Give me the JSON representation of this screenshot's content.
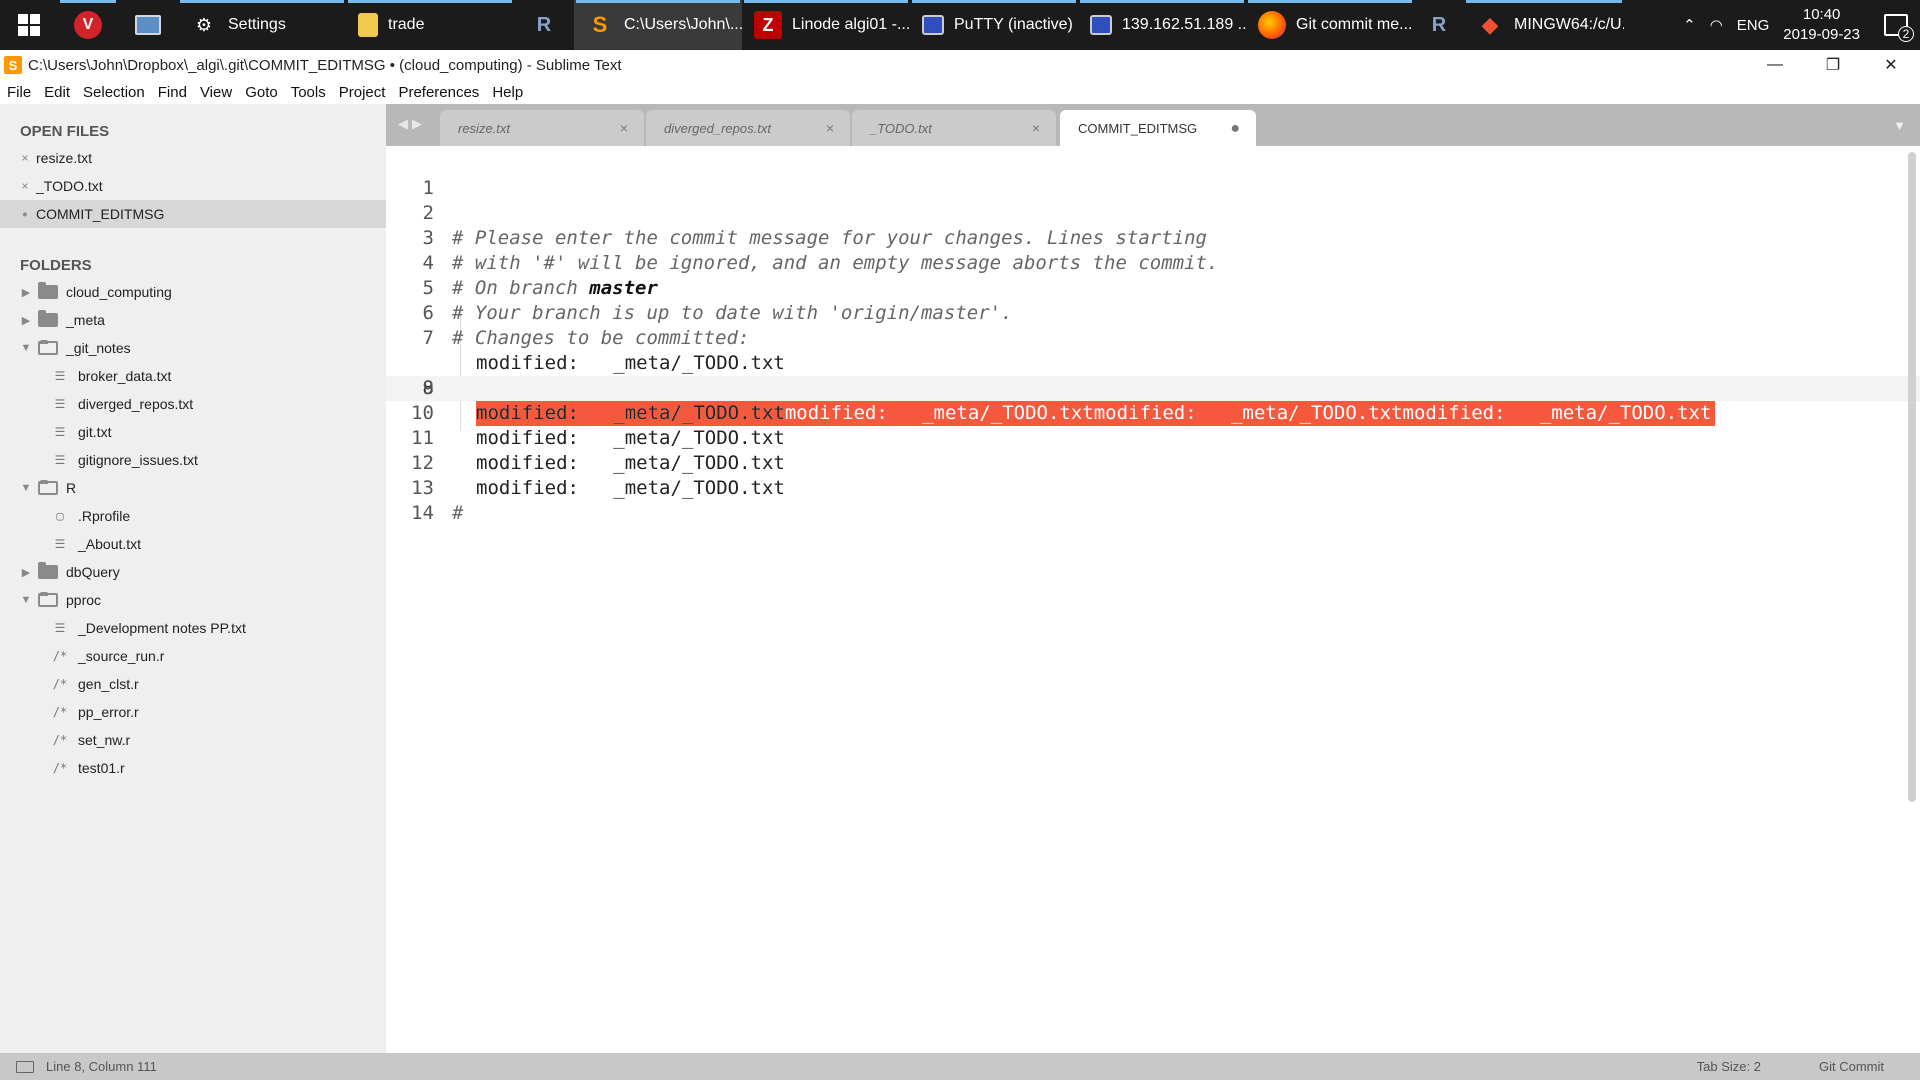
{
  "taskbar": {
    "items": [
      {
        "label": "Settings",
        "icon": "gear-icon"
      },
      {
        "label": "trade",
        "icon": "folder-icon"
      },
      {
        "label": "C:\\Users\\John\\...",
        "icon": "sublime-icon"
      },
      {
        "label": "Linode algi01 -...",
        "icon": "filezilla-icon"
      },
      {
        "label": "PuTTY (inactive)",
        "icon": "putty-icon"
      },
      {
        "label": "139.162.51.189 ...",
        "icon": "putty-icon"
      },
      {
        "label": "Git commit me...",
        "icon": "firefox-icon"
      },
      {
        "label": "MINGW64:/c/U...",
        "icon": "git-icon"
      }
    ],
    "tray": {
      "lang": "ENG",
      "time": "10:40",
      "date": "2019-09-23",
      "notifications": "2"
    }
  },
  "window": {
    "title": "C:\\Users\\John\\Dropbox\\_algi\\.git\\COMMIT_EDITMSG • (cloud_computing) - Sublime Text",
    "menu": [
      "File",
      "Edit",
      "Selection",
      "Find",
      "View",
      "Goto",
      "Tools",
      "Project",
      "Preferences",
      "Help"
    ]
  },
  "sidebar": {
    "open_files_title": "OPEN FILES",
    "open_files": [
      {
        "label": "resize.txt",
        "marker": "×"
      },
      {
        "label": "_TODO.txt",
        "marker": "×"
      },
      {
        "label": "COMMIT_EDITMSG",
        "marker": "●"
      }
    ],
    "folders_title": "FOLDERS",
    "tree": [
      {
        "label": "cloud_computing",
        "type": "folder",
        "open": false,
        "depth": 0
      },
      {
        "label": "_meta",
        "type": "folder",
        "open": false,
        "depth": 0
      },
      {
        "label": "_git_notes",
        "type": "folder",
        "open": true,
        "depth": 0
      },
      {
        "label": "broker_data.txt",
        "type": "txt",
        "depth": 1
      },
      {
        "label": "diverged_repos.txt",
        "type": "txt",
        "depth": 1
      },
      {
        "label": "git.txt",
        "type": "txt",
        "depth": 1
      },
      {
        "label": "gitignore_issues.txt",
        "type": "txt",
        "depth": 1
      },
      {
        "label": "R",
        "type": "folder",
        "open": true,
        "depth": 0
      },
      {
        "label": ".Rprofile",
        "type": "plain",
        "depth": 1
      },
      {
        "label": "_About.txt",
        "type": "txt",
        "depth": 1
      },
      {
        "label": "dbQuery",
        "type": "folder",
        "open": false,
        "depth": 0
      },
      {
        "label": "pproc",
        "type": "folder",
        "open": true,
        "depth": 0
      },
      {
        "label": "_Development notes PP.txt",
        "type": "txt",
        "depth": 1
      },
      {
        "label": "_source_run.r",
        "type": "r",
        "depth": 1
      },
      {
        "label": "gen_clst.r",
        "type": "r",
        "depth": 1
      },
      {
        "label": "pp_error.r",
        "type": "r",
        "depth": 1
      },
      {
        "label": "set_nw.r",
        "type": "r",
        "depth": 1
      },
      {
        "label": "test01.r",
        "type": "r",
        "depth": 1
      }
    ]
  },
  "tabs": [
    {
      "label": "resize.txt",
      "close": "×",
      "active": false
    },
    {
      "label": "diverged_repos.txt",
      "close": "×",
      "active": false
    },
    {
      "label": "_TODO.txt",
      "close": "×",
      "active": false
    },
    {
      "label": "COMMIT_EDITMSG",
      "close": "●",
      "active": true
    }
  ],
  "editor": {
    "current_line": 8,
    "lines": [
      {
        "n": "1",
        "text": ""
      },
      {
        "n": "2",
        "text": "# Please enter the commit message for your changes. Lines starting",
        "kind": "comment"
      },
      {
        "n": "3",
        "text": "# with '#' will be ignored, and an empty message aborts the commit.",
        "kind": "comment"
      },
      {
        "n": "4",
        "text": "# On branch ",
        "bold": "master",
        "kind": "comment"
      },
      {
        "n": "5",
        "text": "# Your branch is up to date with 'origin/master'.",
        "kind": "comment"
      },
      {
        "n": "6",
        "text": "# Changes to be committed:",
        "kind": "comment"
      },
      {
        "n": "7",
        "text": "modified:   _meta/_TODO.txt",
        "kind": "indent"
      },
      {
        "n": "8",
        "text": "modified:   _meta/_TODO.txtmodified:   _meta/_TODO.txtmodified:   _meta/_TODO.txtmodified:   _meta/_TODO.txt",
        "kind": "error"
      },
      {
        "n": "9",
        "text": "modified:   _meta/_TODO.txt",
        "kind": "indent"
      },
      {
        "n": "10",
        "text": "modified:   _meta/_TODO.txt",
        "kind": "indent"
      },
      {
        "n": "11",
        "text": "modified:   _meta/_TODO.txt",
        "kind": "indent"
      },
      {
        "n": "12",
        "text": "modified:   _meta/_TODO.txt",
        "kind": "indent"
      },
      {
        "n": "13",
        "text": "#",
        "kind": "comment"
      },
      {
        "n": "14",
        "text": ""
      }
    ]
  },
  "status": {
    "position": "Line 8, Column 111",
    "tab_size": "Tab Size: 2",
    "syntax": "Git Commit"
  },
  "colors": {
    "error_highlight": "#f5593d",
    "taskbar_accent": "#76b9ed",
    "sidebar_bg": "#efefef",
    "tabbar_bg": "#b8b8b8"
  }
}
